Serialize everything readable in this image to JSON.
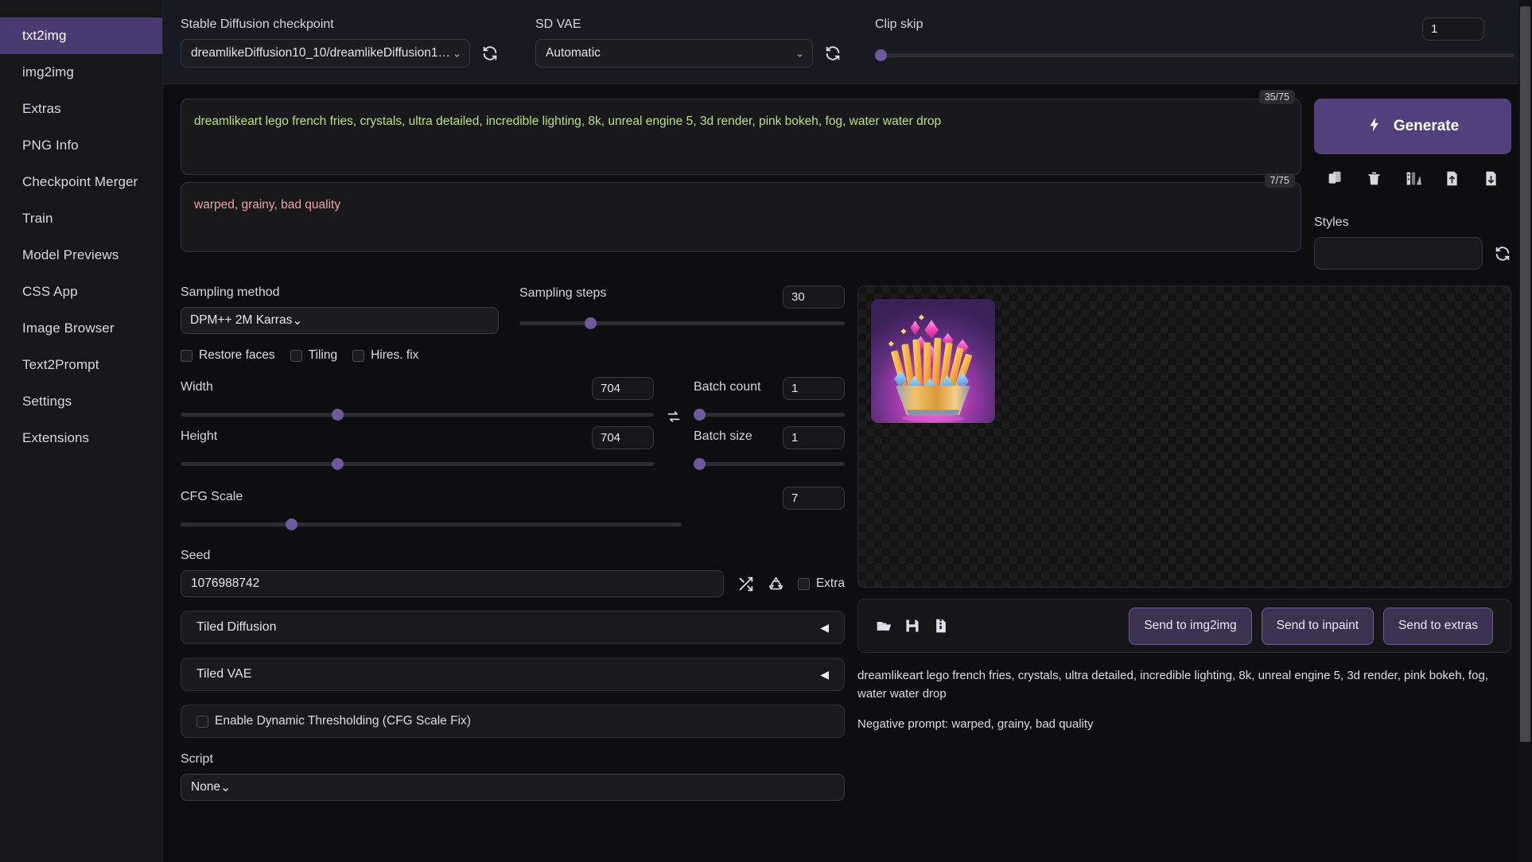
{
  "sidebar": {
    "items": [
      {
        "label": "txt2img",
        "active": true
      },
      {
        "label": "img2img",
        "active": false
      },
      {
        "label": "Extras",
        "active": false
      },
      {
        "label": "PNG Info",
        "active": false
      },
      {
        "label": "Checkpoint Merger",
        "active": false
      },
      {
        "label": "Train",
        "active": false
      },
      {
        "label": "Model Previews",
        "active": false
      },
      {
        "label": "CSS App",
        "active": false
      },
      {
        "label": "Image Browser",
        "active": false
      },
      {
        "label": "Text2Prompt",
        "active": false
      },
      {
        "label": "Settings",
        "active": false
      },
      {
        "label": "Extensions",
        "active": false
      }
    ]
  },
  "topbar": {
    "checkpoint": {
      "label": "Stable Diffusion checkpoint",
      "value": "dreamlikeDiffusion10_10/dreamlikeDiffusion1…",
      "refresh_icon": "refresh-icon"
    },
    "vae": {
      "label": "SD VAE",
      "value": "Automatic",
      "refresh_icon": "refresh-icon"
    },
    "clip_skip": {
      "label": "Clip skip",
      "value": "1",
      "slider_percent": 0
    }
  },
  "prompt": {
    "positive": {
      "text": "dreamlikeart lego french fries, crystals, ultra detailed, incredible lighting, 8k, unreal engine 5, 3d render, pink bokeh, fog, water water drop",
      "tokens": "35/75"
    },
    "negative": {
      "text": "warped, grainy, bad quality",
      "tokens": "7/75"
    }
  },
  "generate": {
    "label": "Generate",
    "bolt_icon": "bolt-icon",
    "icons": [
      {
        "name": "paste-icon"
      },
      {
        "name": "trash-icon"
      },
      {
        "name": "palette-icon"
      },
      {
        "name": "save-style-icon"
      },
      {
        "name": "load-style-icon"
      }
    ],
    "styles_label": "Styles",
    "styles_value": "",
    "styles_refresh_icon": "refresh-icon"
  },
  "params": {
    "sampling_method": {
      "label": "Sampling method",
      "value": "DPM++ 2M Karras"
    },
    "sampling_steps": {
      "label": "Sampling steps",
      "value": "30",
      "slider_percent": 21
    },
    "checkboxes": [
      {
        "label": "Restore faces",
        "checked": false
      },
      {
        "label": "Tiling",
        "checked": false
      },
      {
        "label": "Hires. fix",
        "checked": false
      }
    ],
    "width": {
      "label": "Width",
      "value": "704",
      "slider_percent": 33
    },
    "height": {
      "label": "Height",
      "value": "704",
      "slider_percent": 33
    },
    "batch_count": {
      "label": "Batch count",
      "value": "1",
      "slider_percent": 1
    },
    "batch_size": {
      "label": "Batch size",
      "value": "1",
      "slider_percent": 1
    },
    "swap_icon": "swap-dimensions-icon",
    "cfg_scale": {
      "label": "CFG Scale",
      "value": "7",
      "slider_percent": 21
    },
    "seed": {
      "label": "Seed",
      "value": "1076988742",
      "shuffle_icon": "dice-shuffle-icon",
      "recycle_icon": "recycle-seed-icon",
      "extra_label": "Extra",
      "extra_checked": false
    },
    "accordions": [
      {
        "label": "Tiled Diffusion",
        "collapsed": true
      },
      {
        "label": "Tiled VAE",
        "collapsed": true
      }
    ],
    "dynamic_thresholding": {
      "label": "Enable Dynamic Thresholding (CFG Scale Fix)",
      "checked": false
    },
    "script": {
      "label": "Script",
      "value": "None"
    }
  },
  "result": {
    "image_alt": "3d render of golden french fries with pink crystals in metallic cup on purple background",
    "actions": [
      {
        "name": "open-folder-icon"
      },
      {
        "name": "save-icon"
      },
      {
        "name": "save-zip-icon"
      }
    ],
    "send_buttons": [
      {
        "label": "Send to img2img"
      },
      {
        "label": "Send to inpaint"
      },
      {
        "label": "Send to extras"
      }
    ],
    "info_prompt": "dreamlikeart lego french fries, crystals, ultra detailed, incredible lighting, 8k, unreal engine 5, 3d render, pink bokeh, fog, water water drop",
    "info_negative": "Negative prompt: warped, grainy, bad quality"
  },
  "colors": {
    "accent": "#52407c",
    "sidebar_active": "#4a3a72",
    "slider_knob": "#6c5a9c",
    "positive_prompt_text": "#b7e089",
    "negative_prompt_text": "#e8a3a3"
  }
}
